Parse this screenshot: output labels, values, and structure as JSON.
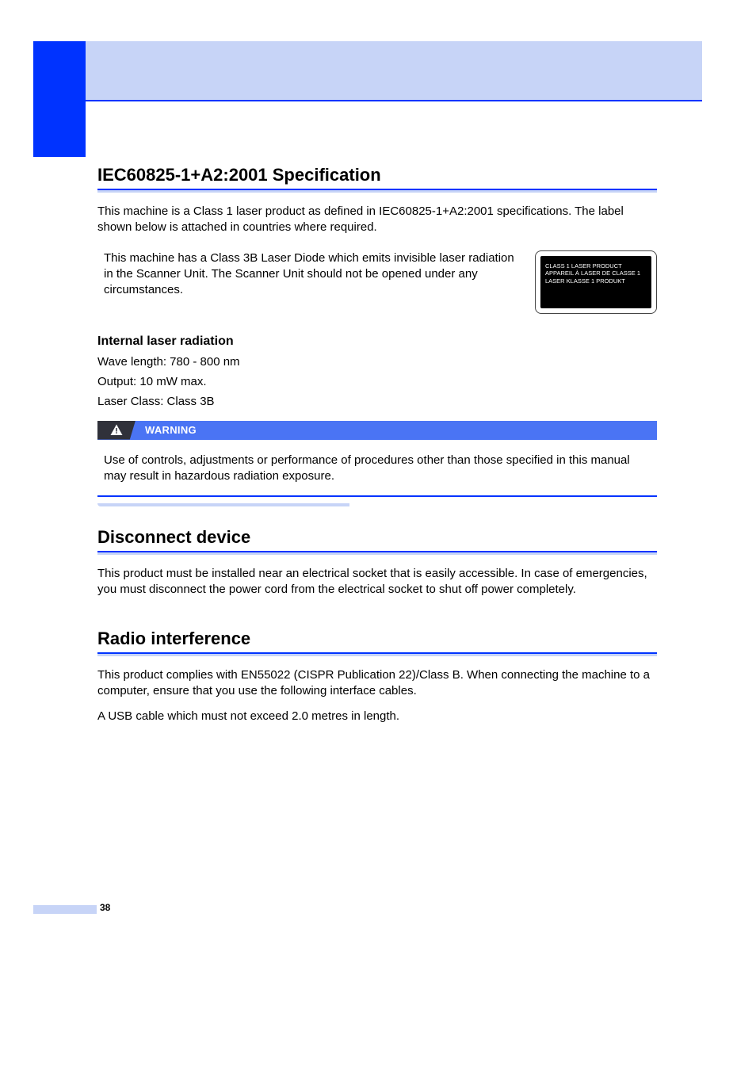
{
  "page_number": "38",
  "sections": {
    "iec": {
      "title": "IEC60825-1+A2:2001 Specification",
      "intro": "This machine is a Class 1 laser product as defined in IEC60825-1+A2:2001 specifications. The label shown below is attached in countries where required.",
      "diode_text": "This machine has a Class 3B Laser Diode which emits invisible laser radiation in the Scanner Unit. The Scanner Unit should not be opened under any circumstances.",
      "label_lines": {
        "l1": "CLASS 1 LASER PRODUCT",
        "l2": "APPAREIL À LASER DE CLASSE 1",
        "l3": "LASER KLASSE 1 PRODUKT"
      },
      "internal": {
        "heading": "Internal laser radiation",
        "wave": "Wave length: 780 - 800 nm",
        "output": "Output: 10 mW max.",
        "class": "Laser Class: Class 3B"
      },
      "warning": {
        "label": "WARNING",
        "body": "Use of controls, adjustments or performance of procedures other than those specified in this manual may result in hazardous radiation exposure."
      }
    },
    "disconnect": {
      "title": "Disconnect device",
      "body": "This product must be installed near an electrical socket that is easily accessible. In case of emergencies, you must disconnect the power cord from the electrical socket to shut off power completely."
    },
    "radio": {
      "title": "Radio interference",
      "body1": "This product complies with EN55022 (CISPR Publication 22)/Class B. When connecting the machine to a computer, ensure that you use the following interface cables.",
      "body2": "A USB cable which must not exceed 2.0 metres in length."
    }
  }
}
